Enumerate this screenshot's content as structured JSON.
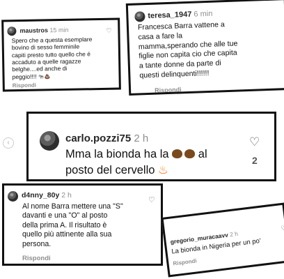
{
  "card1": {
    "username": "maustros",
    "time": "15 min",
    "lines": [
      "Spero che a questa esemplare",
      "bovino di sesso femminile",
      "capiti presto tutto quello che é",
      "accaduto a quelle ragazze",
      "belghe....ed anche di",
      "peggio!!!! "
    ],
    "emojis": [
      "🐄",
      "💩"
    ],
    "reply": "Rispondi"
  },
  "card2": {
    "username": "teresa_1947",
    "time": "6 min",
    "lines": [
      "Francesca Barra vattene a",
      "casa a fare la",
      "mamma,sperando che alle tue",
      "figlie non capita cio che capita",
      "a tante donne da parte di",
      "questi delinquenti!!!!!!"
    ],
    "reply": "Rispondi"
  },
  "card3": {
    "username": "carlo.pozzi75",
    "time": "2 h",
    "line1_a": "Mma la bionda ha la",
    "line1_b": "al",
    "line2": "posto del cervello",
    "like_count": "2",
    "emojis": [
      "💩",
      "💩",
      "🔥"
    ]
  },
  "card4": {
    "username": "d4nny_80y",
    "time": "2 h",
    "lines": [
      "Al nome Barra mettere una \"S\"",
      "davanti e una \"O\" al posto",
      "della prima A. Il risultato è",
      "quello più attinente alla sua",
      "persona."
    ],
    "reply": "Rispondi"
  },
  "card5": {
    "username": "gregorio_muracaavv",
    "time": "2 h",
    "line": "La bionda in Nigeria per un po'",
    "reply": "Rispondi"
  },
  "icons": {
    "heart": "heart-icon",
    "nav_prev": "chevron-left-icon"
  },
  "colors": {
    "border": "#111111",
    "time": "#8e8e8e",
    "username": "#262626"
  }
}
